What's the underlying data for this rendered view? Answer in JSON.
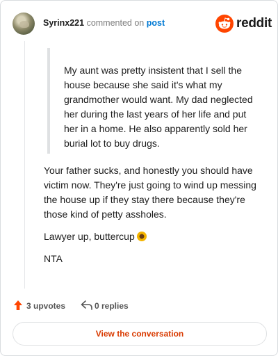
{
  "header": {
    "username": "Syrinx221",
    "action_text": "commented on",
    "post_link": "post",
    "logo_text": "reddit",
    "avatar_icon": "avatar-image",
    "logo_icon": "reddit-logo-icon"
  },
  "quote": {
    "text": "My aunt was pretty insistent that I sell the house because she said it's what my grandmother would want. My dad neglected her during the last years of her life and put her in a home. He also apparently sold her burial lot to buy drugs."
  },
  "comment": {
    "paragraph1": "Your father sucks, and honestly you should have victim now. They're just going to wind up messing the house up if they stay there because they're those kind of petty assholes.",
    "paragraph2": "Lawyer up, buttercup",
    "paragraph3": "NTA"
  },
  "actions": {
    "upvotes": "3 upvotes",
    "replies": "0 replies",
    "upvote_icon": "upvote-arrow-icon",
    "reply_icon": "reply-arrow-icon"
  },
  "button": {
    "label": "View the conversation"
  },
  "colors": {
    "accent": "#d93a00",
    "brand": "#ff4500",
    "link": "#0079d3"
  }
}
